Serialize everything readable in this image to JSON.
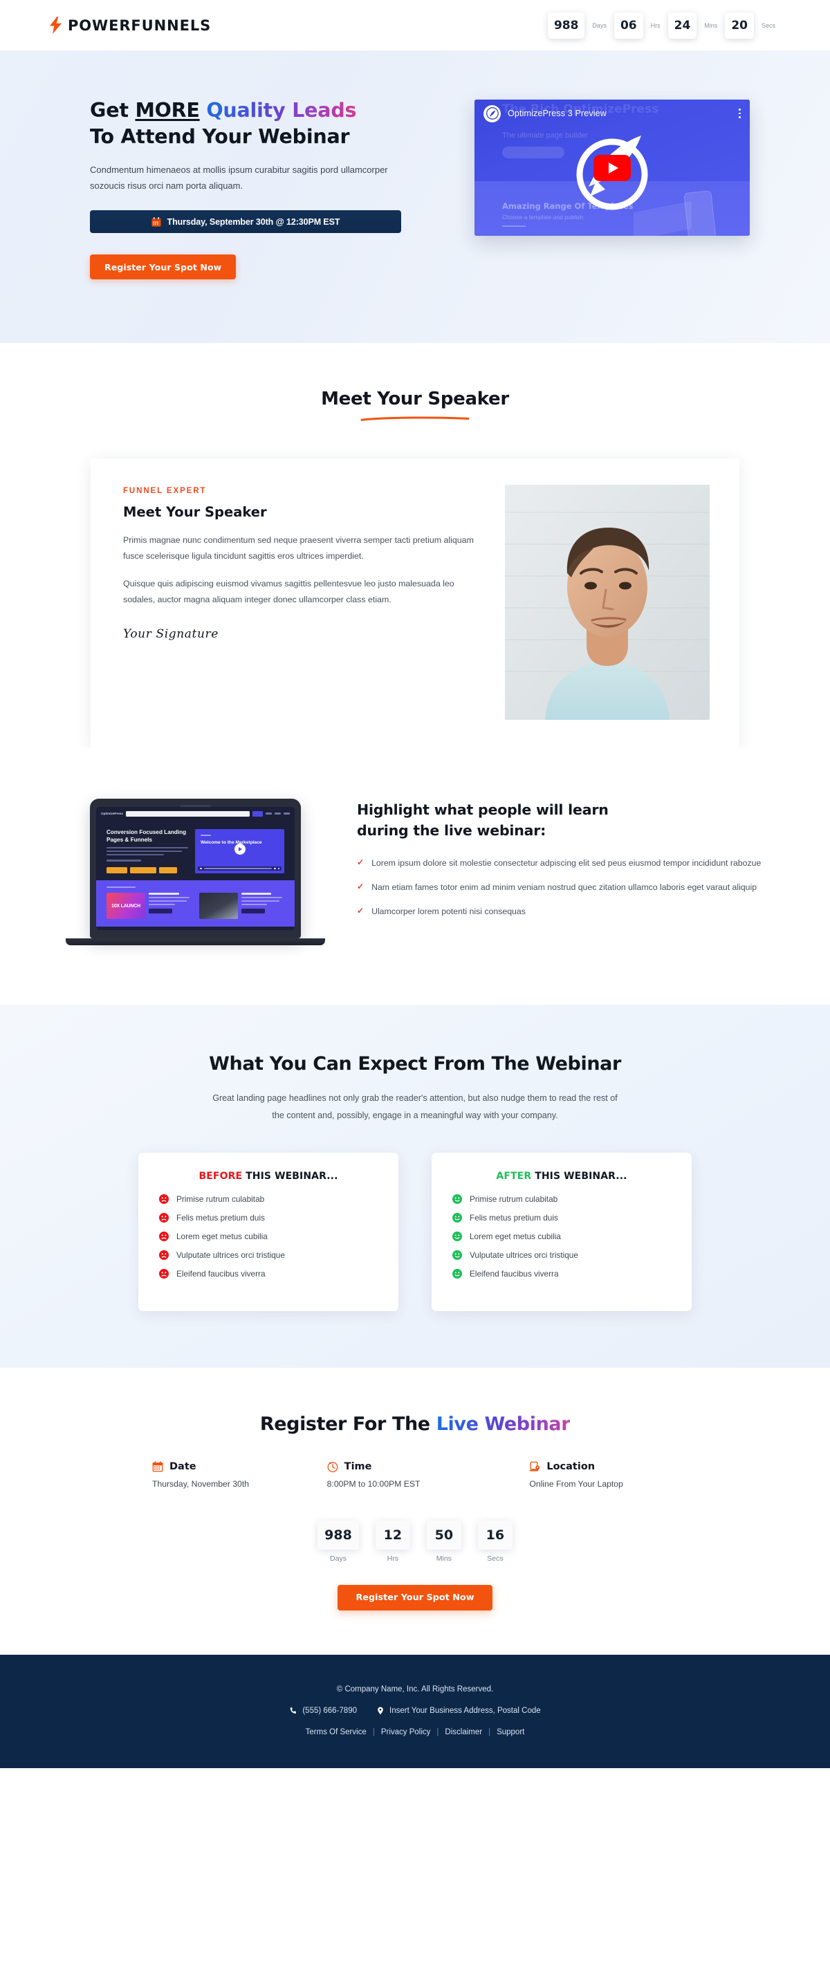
{
  "header": {
    "brand_name": "POWERFUNNELS",
    "bolt_icon": "lightning-bolt-icon",
    "bolt_color": "#f2530f",
    "countdown": [
      {
        "value": "988",
        "label": "Days"
      },
      {
        "value": "06",
        "label": "Hrs"
      },
      {
        "value": "24",
        "label": "Mins"
      },
      {
        "value": "20",
        "label": "Secs"
      }
    ]
  },
  "hero": {
    "title_line1_plain": "Get ",
    "title_line1_underlined": "MORE",
    "title_line1_gradient": " Quality Leads",
    "title_line2": "To Attend Your Webinar",
    "subtitle": "Condmentum himenaeos at mollis ipsum curabitur sagitis pord ullamcorper sozoucis risus orci nam porta aliquam.",
    "date_badge": "Thursday, September 30th @ 12:30PM EST",
    "cta_label": "Register Your Spot Now",
    "video": {
      "title": "OptimizePress 3 Preview",
      "ghost_title": "The Rich OptimizePress",
      "ghost_sub": "The ultimate page builder",
      "ghost_heading": "Amazing Range Of Templates",
      "ghost_para": "Choose a template and publish",
      "play_icon": "youtube-play-icon",
      "menu_icon": "kebab-menu-icon"
    }
  },
  "speaker_section": {
    "heading": "Meet Your Speaker",
    "card": {
      "eyebrow": "FUNNEL EXPERT",
      "title": "Meet Your Speaker",
      "paragraph1": "Primis magnae nunc condimentum sed neque praesent viverra semper tacti pretium aliquam fusce scelerisque ligula tincidunt sagittis eros ultrices imperdiet.",
      "paragraph2": "Quisque quis adipiscing euismod vivamus sagittis pellentesvue leo justo malesuada leo sodales, auctor magna aliquam integer donec ullamcorper class etiam.",
      "signature": "Your Signature"
    }
  },
  "learn_section": {
    "title_line1": "Highlight what people will learn",
    "title_line2": "during the live webinar:",
    "bullets": [
      "Lorem ipsum dolore sit molestie consectetur adpiscing elit sed peus eiusmod tempor incididunt rabozue",
      "Nam etiam fames totor enim ad minim veniam nostrud quec zitation ullamco laboris eget varaut aliquip",
      "Ulamcorper lorem potenti nisi consequas"
    ],
    "bullet_icon": "check-mark-icon",
    "laptop_mockup": {
      "brand": "OptimizePress",
      "headline": "Conversion Focused Landing Pages & Funnels",
      "video_text": "Welcome to the Marketplace",
      "card1_badge": "10X LAUNCH"
    }
  },
  "expect_section": {
    "title": "What You Can Expect From The Webinar",
    "subtitle": "Great landing page headlines not only grab the reader's attention, but also nudge them to read the rest of the content and, possibly, engage in a meaningful way with your company.",
    "before": {
      "accent_word": "BEFORE",
      "head_rest": " THIS WEBINAR...",
      "accent_color": "#e8161a",
      "icon": "sad-face-icon",
      "items": [
        "Primise rutrum culabitab",
        "Felis metus pretium duis",
        "Lorem eget metus cubilia",
        "Vulputate ultrices orci tristique",
        "Eleifend faucibus viverra"
      ]
    },
    "after": {
      "accent_word": "AFTER",
      "head_rest": " THIS WEBINAR...",
      "accent_color": "#1fbf5a",
      "icon": "happy-face-icon",
      "items": [
        "Primise rutrum culabitab",
        "Felis metus pretium duis",
        "Lorem eget metus cubilia",
        "Vulputate ultrices orci tristique",
        "Eleifend faucibus viverra"
      ]
    }
  },
  "register_section": {
    "title_plain": "Register For The ",
    "title_gradient": "Live Webinar",
    "details": [
      {
        "icon": "calendar-icon",
        "label": "Date",
        "value": "Thursday, November 30th"
      },
      {
        "icon": "clock-icon",
        "label": "Time",
        "value": "8:00PM to 10:00PM EST"
      },
      {
        "icon": "laptop-location-icon",
        "label": "Location",
        "value": "Online From Your Laptop"
      }
    ],
    "countdown": [
      {
        "value": "988",
        "label": "Days"
      },
      {
        "value": "12",
        "label": "Hrs"
      },
      {
        "value": "50",
        "label": "Mins"
      },
      {
        "value": "16",
        "label": "Secs"
      }
    ],
    "cta_label": "Register Your Spot Now"
  },
  "footer": {
    "copyright": "© Company Name, Inc. All Rights Reserved.",
    "phone": "(555) 666-7890",
    "phone_icon": "phone-icon",
    "address": "Insert Your Business Address, Postal Code",
    "address_icon": "map-pin-icon",
    "links": [
      "Terms Of Service",
      "Privacy Policy",
      "Disclaimer",
      "Support"
    ],
    "background_color": "#0d2748"
  },
  "theme": {
    "accent_orange": "#f2530f",
    "navy": "#0d2748",
    "eyebrow_red": "#ef4a20"
  }
}
